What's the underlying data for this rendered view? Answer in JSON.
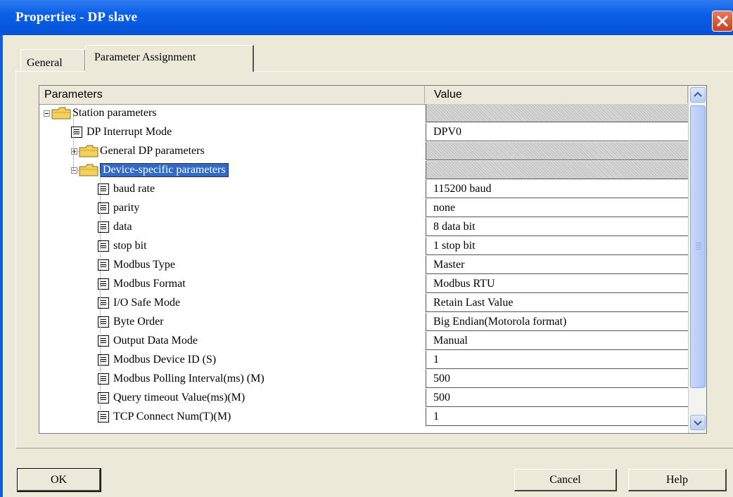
{
  "window": {
    "title": "Properties - DP slave"
  },
  "tabs": {
    "general": "General",
    "parameter_assignment": "Parameter Assignment"
  },
  "grid": {
    "header": {
      "parameters": "Parameters",
      "value": "Value"
    },
    "rows": [
      {
        "label": "Station parameters",
        "value": "",
        "kind": "folder",
        "level": 0,
        "expander": "minus"
      },
      {
        "label": "DP Interrupt Mode",
        "value": "DPV0",
        "kind": "param",
        "level": 1
      },
      {
        "label": "General DP parameters",
        "value": "",
        "kind": "folder",
        "level": 1,
        "expander": "plus"
      },
      {
        "label": "Device-specific parameters",
        "value": "",
        "kind": "folder",
        "level": 1,
        "expander": "minus",
        "selected": true
      },
      {
        "label": "baud rate",
        "value": "115200 baud",
        "kind": "param",
        "level": 2
      },
      {
        "label": "parity",
        "value": "none",
        "kind": "param",
        "level": 2
      },
      {
        "label": "data",
        "value": "8 data bit",
        "kind": "param",
        "level": 2
      },
      {
        "label": "stop bit",
        "value": "1 stop bit",
        "kind": "param",
        "level": 2
      },
      {
        "label": "Modbus Type",
        "value": "Master",
        "kind": "param",
        "level": 2
      },
      {
        "label": "Modbus Format",
        "value": "Modbus RTU",
        "kind": "param",
        "level": 2
      },
      {
        "label": "I/O Safe Mode",
        "value": "Retain Last Value",
        "kind": "param",
        "level": 2
      },
      {
        "label": "Byte Order",
        "value": "Big Endian(Motorola  format)",
        "kind": "param",
        "level": 2
      },
      {
        "label": "Output Data Mode",
        "value": "Manual",
        "kind": "param",
        "level": 2
      },
      {
        "label": "Modbus Device ID (S)",
        "value": "1",
        "kind": "param",
        "level": 2
      },
      {
        "label": "Modbus Polling Interval(ms) (M)",
        "value": "500",
        "kind": "param",
        "level": 2
      },
      {
        "label": "Query timeout Value(ms)(M)",
        "value": "500",
        "kind": "param",
        "level": 2
      },
      {
        "label": "TCP  Connect  Num(T)(M)",
        "value": "1",
        "kind": "param",
        "level": 2
      }
    ]
  },
  "buttons": {
    "ok": "OK",
    "cancel": "Cancel",
    "help": "Help"
  },
  "icons": {
    "close": "close-icon",
    "folder": "folder-icon",
    "parameter": "parameter-icon",
    "scroll_up": "arrow-up-icon",
    "scroll_down": "arrow-down-icon"
  },
  "colors": {
    "titlebar": "#0a5fe6",
    "selection": "#316ac5",
    "dialog": "#ece9d8"
  }
}
